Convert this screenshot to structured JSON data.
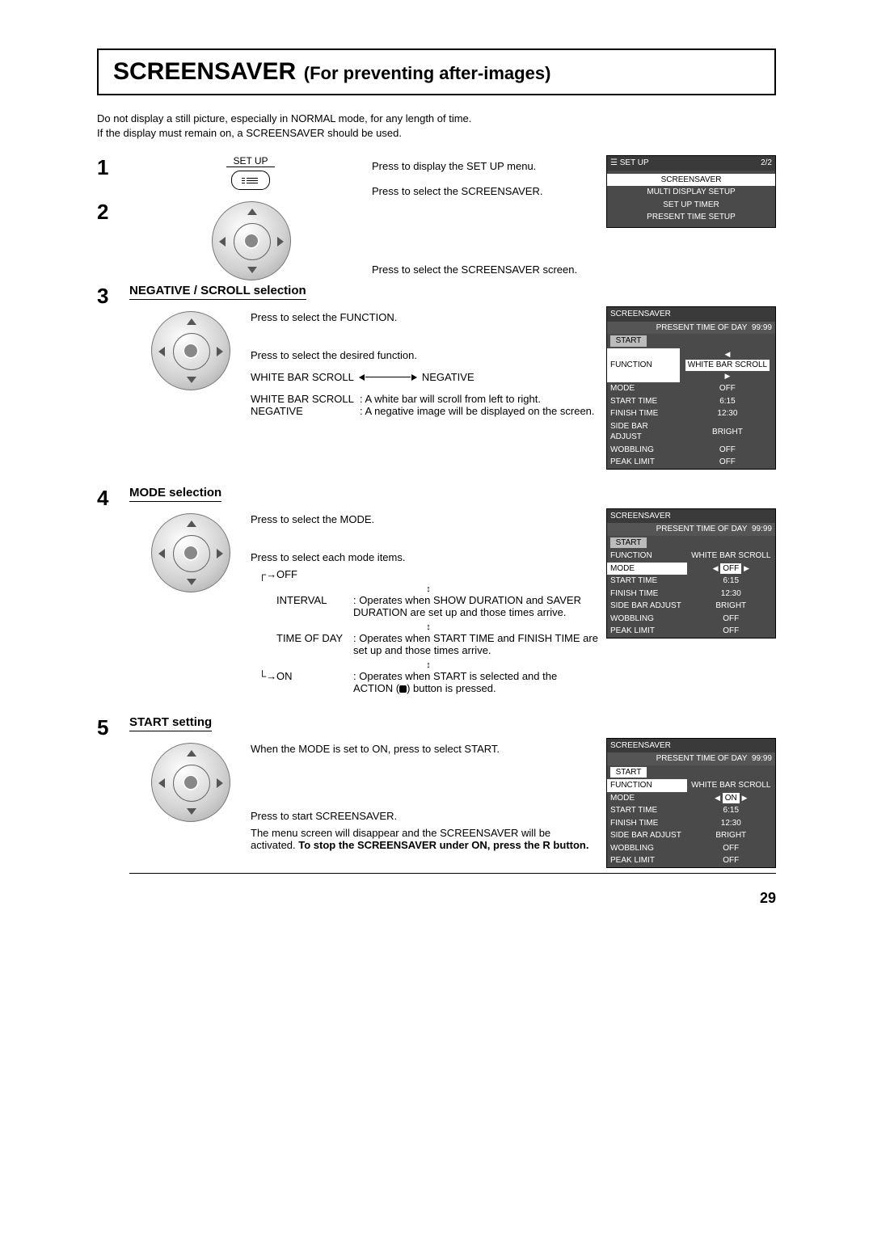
{
  "title_main": "SCREENSAVER",
  "title_sub": "(For preventing after-images)",
  "intro_l1": "Do not display a still picture, especially in NORMAL mode, for any length of time.",
  "intro_l2": "If the display must remain on, a SCREENSAVER should be used.",
  "step1": {
    "num": "1",
    "btn_label": "SET UP",
    "text": "Press to display the SET UP menu."
  },
  "step2": {
    "num": "2",
    "text_a": "Press to select the SCREENSAVER.",
    "text_b": "Press to select the SCREENSAVER screen."
  },
  "setup_menu": {
    "header": "SET UP",
    "page": "2/2",
    "items": [
      "SCREENSAVER",
      "MULTI DISPLAY SETUP",
      "SET UP TIMER",
      "PRESENT TIME SETUP"
    ]
  },
  "step3": {
    "num": "3",
    "heading": "NEGATIVE / SCROLL selection",
    "line_a": "Press to select the FUNCTION.",
    "line_b": "Press to select the desired function.",
    "opt_left": "WHITE BAR SCROLL",
    "opt_right": "NEGATIVE",
    "desc_wbs_label": "WHITE BAR SCROLL",
    "desc_wbs_text": ": A white bar will scroll from left to right.",
    "desc_neg_label": "NEGATIVE",
    "desc_neg_text": ": A negative image will be displayed on the screen."
  },
  "ss_menu_common": {
    "title": "SCREENSAVER",
    "present_label": "PRESENT  TIME OF DAY",
    "present_value": "99:99",
    "start": "START",
    "rows": {
      "function": "FUNCTION",
      "mode": "MODE",
      "start_time": "START TIME",
      "finish_time": "FINISH TIME",
      "side_bar": "SIDE BAR ADJUST",
      "wobbling": "WOBBLING",
      "peak": "PEAK LIMIT"
    },
    "vals": {
      "function": "WHITE BAR SCROLL",
      "mode_off": "OFF",
      "mode_on": "ON",
      "start_time": "6:15",
      "finish_time": "12:30",
      "side_bar": "BRIGHT",
      "wobbling": "OFF",
      "peak": "OFF"
    }
  },
  "step4": {
    "num": "4",
    "heading": "MODE selection",
    "line_a": "Press to select the MODE.",
    "line_b": "Press to select each mode items.",
    "modes": {
      "off": "OFF",
      "interval": "INTERVAL",
      "interval_desc": ": Operates when SHOW DURATION and SAVER DURATION are set up and those times arrive.",
      "timeofday": "TIME OF DAY",
      "timeofday_desc": ": Operates when START TIME and FINISH TIME are set up and those times arrive.",
      "on": "ON",
      "on_desc_a": ": Operates when START is selected and the ACTION (",
      "on_desc_b": ") button is pressed."
    }
  },
  "step5": {
    "num": "5",
    "heading": "START setting",
    "line_a": "When the MODE is set to ON, press to select START.",
    "line_b": "Press to start SCREENSAVER.",
    "line_c_a": "The menu screen will disappear and the SCREENSAVER will be activated. ",
    "line_c_b": "To stop the SCREENSAVER under ON, press the R button."
  },
  "pagenum": "29"
}
